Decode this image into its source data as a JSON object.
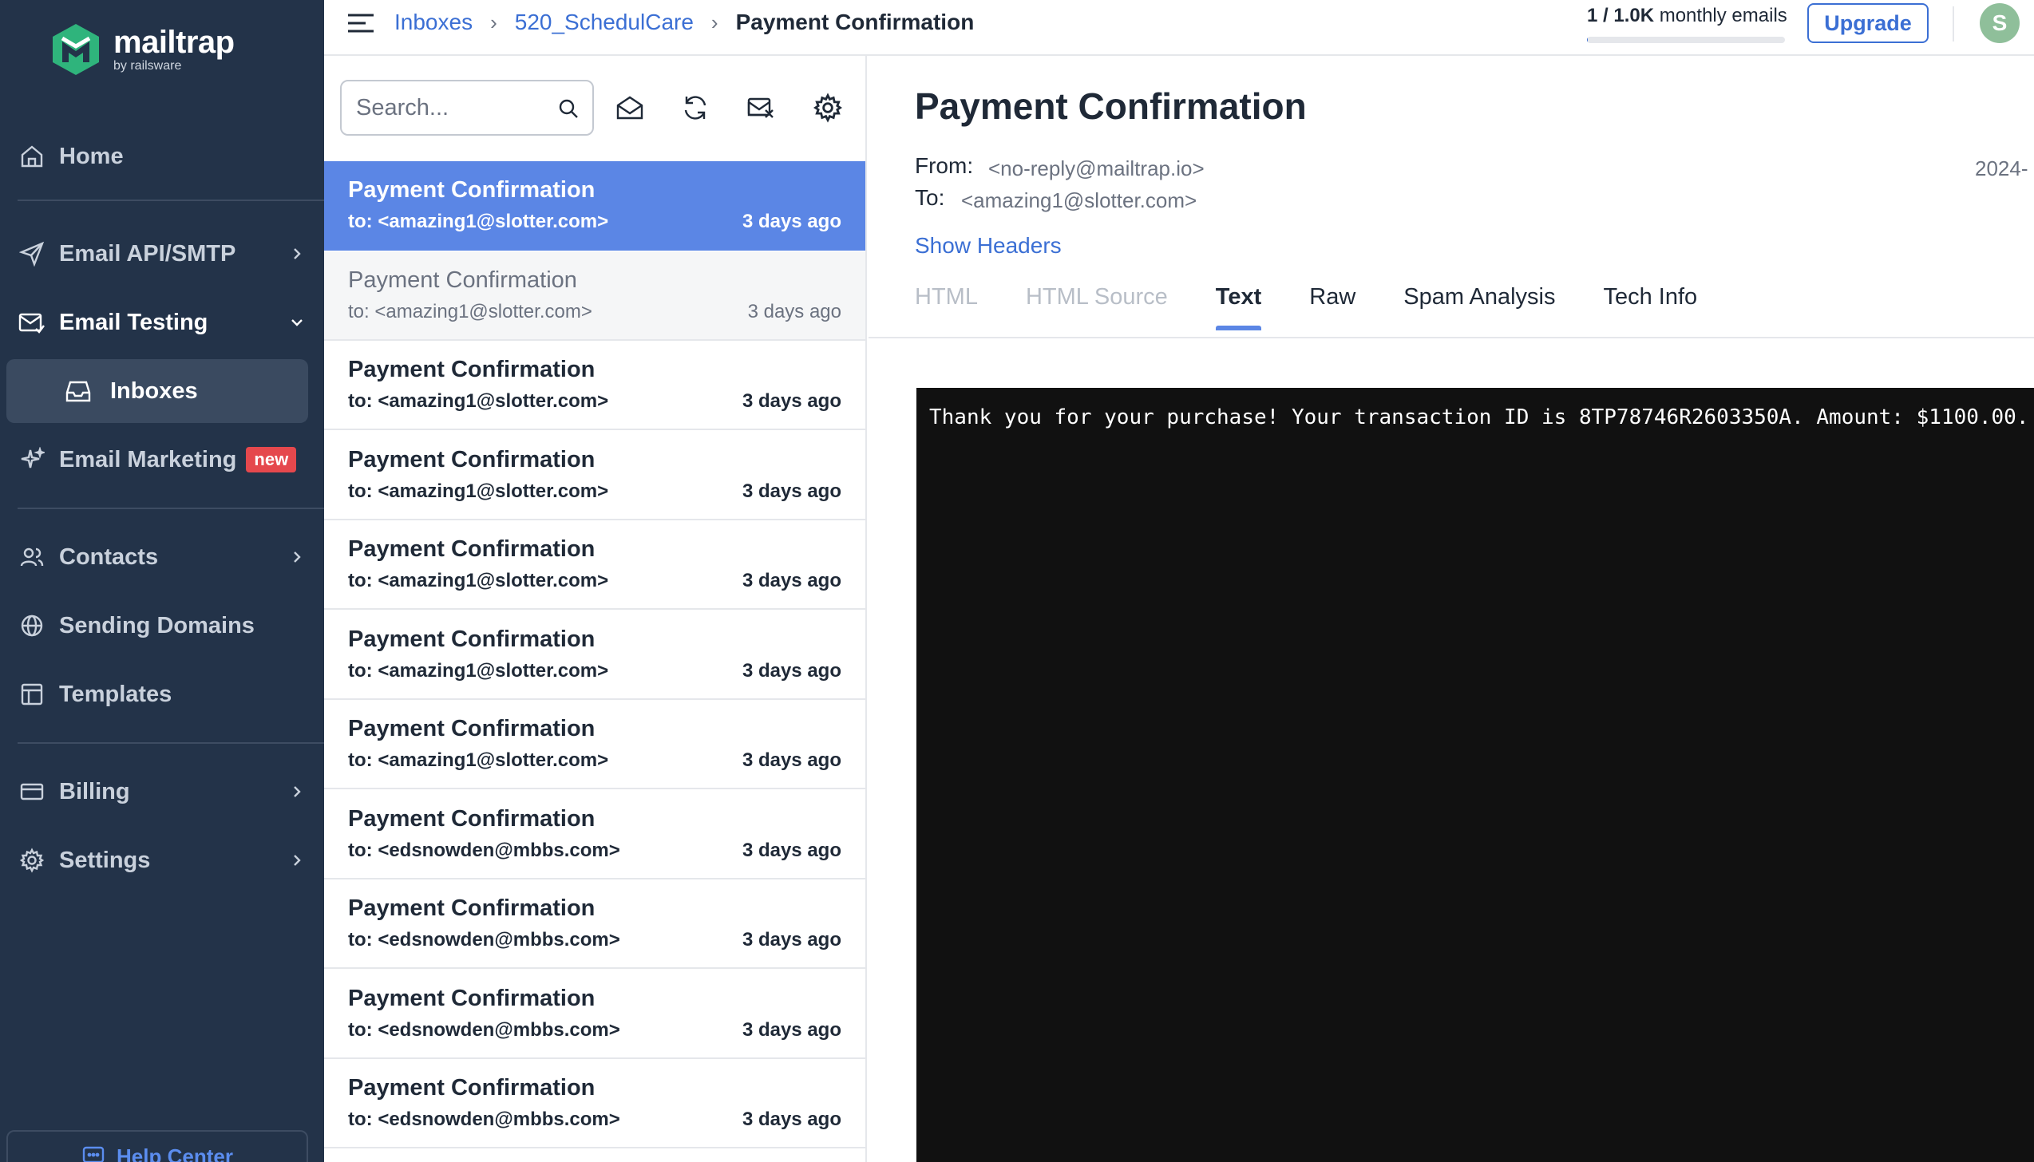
{
  "sidebar": {
    "logo": {
      "name": "mailtrap",
      "sub": "by railsware"
    },
    "items": [
      {
        "label": "Home"
      },
      {
        "label": "Email API/SMTP"
      },
      {
        "label": "Email Testing"
      },
      {
        "label": "Inboxes"
      },
      {
        "label": "Email Marketing",
        "badge": "new"
      },
      {
        "label": "Contacts"
      },
      {
        "label": "Sending Domains"
      },
      {
        "label": "Templates"
      },
      {
        "label": "Billing"
      },
      {
        "label": "Settings"
      }
    ],
    "help": "Help Center"
  },
  "topbar": {
    "breadcrumbs": [
      "Inboxes",
      "520_SchedulCare",
      "Payment Confirmation"
    ],
    "usage": {
      "count": "1 / 1.0K",
      "suffix": " monthly emails",
      "fraction": 0.001
    },
    "upgrade": "Upgrade",
    "avatar": "S"
  },
  "list": {
    "search_placeholder": "Search...",
    "messages": [
      {
        "subject": "Payment Confirmation",
        "to": "to: <amazing1@slotter.com>",
        "time": "3 days ago",
        "state": "selected"
      },
      {
        "subject": "Payment Confirmation",
        "to": "to: <amazing1@slotter.com>",
        "time": "3 days ago",
        "state": "read"
      },
      {
        "subject": "Payment Confirmation",
        "to": "to: <amazing1@slotter.com>",
        "time": "3 days ago",
        "state": "unread"
      },
      {
        "subject": "Payment Confirmation",
        "to": "to: <amazing1@slotter.com>",
        "time": "3 days ago",
        "state": "unread"
      },
      {
        "subject": "Payment Confirmation",
        "to": "to: <amazing1@slotter.com>",
        "time": "3 days ago",
        "state": "unread"
      },
      {
        "subject": "Payment Confirmation",
        "to": "to: <amazing1@slotter.com>",
        "time": "3 days ago",
        "state": "unread"
      },
      {
        "subject": "Payment Confirmation",
        "to": "to: <amazing1@slotter.com>",
        "time": "3 days ago",
        "state": "unread"
      },
      {
        "subject": "Payment Confirmation",
        "to": "to: <edsnowden@mbbs.com>",
        "time": "3 days ago",
        "state": "unread"
      },
      {
        "subject": "Payment Confirmation",
        "to": "to: <edsnowden@mbbs.com>",
        "time": "3 days ago",
        "state": "unread"
      },
      {
        "subject": "Payment Confirmation",
        "to": "to: <edsnowden@mbbs.com>",
        "time": "3 days ago",
        "state": "unread"
      },
      {
        "subject": "Payment Confirmation",
        "to": "to: <edsnowden@mbbs.com>",
        "time": "3 days ago",
        "state": "unread"
      }
    ]
  },
  "detail": {
    "title": "Payment Confirmation",
    "from_label": "From:",
    "from": "<no-reply@mailtrap.io>",
    "to_label": "To:",
    "to": "<amazing1@slotter.com>",
    "date": "2024-",
    "show_headers": "Show Headers",
    "tabs": [
      {
        "label": "HTML",
        "state": "disabled"
      },
      {
        "label": "HTML Source",
        "state": "disabled"
      },
      {
        "label": "Text",
        "state": "active"
      },
      {
        "label": "Raw",
        "state": "normal"
      },
      {
        "label": "Spam Analysis",
        "state": "normal"
      },
      {
        "label": "Tech Info",
        "state": "normal"
      }
    ],
    "body_text": "Thank you for your purchase! Your transaction ID is 8TP78746R2603350A. Amount: $1100.00."
  },
  "colors": {
    "sidebar_bg": "#233349",
    "accent": "#5b86e5",
    "link": "#3b6fd4",
    "badge_new": "#e5484d"
  }
}
